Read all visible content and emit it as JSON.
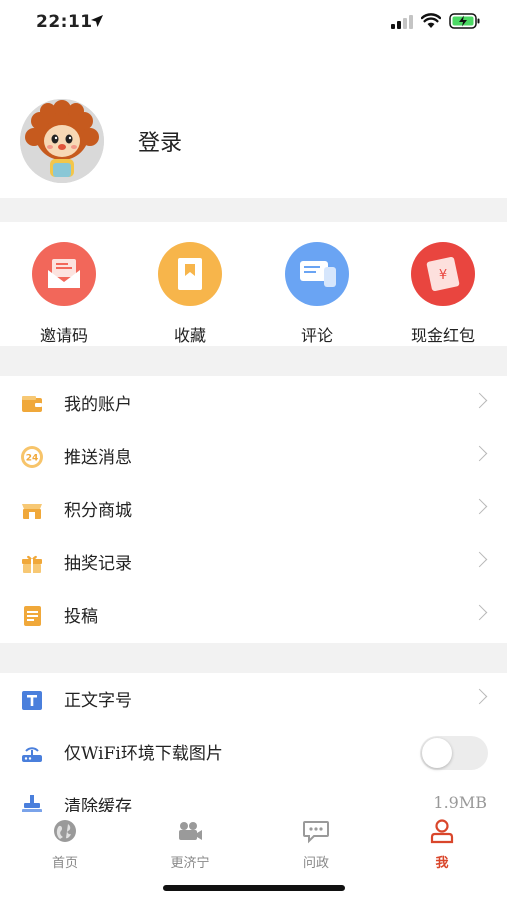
{
  "status": {
    "time": "22:11"
  },
  "profile": {
    "login_label": "登录"
  },
  "quick_actions": [
    {
      "label": "邀请码",
      "icon": "envelope-icon",
      "color": "#f2675a"
    },
    {
      "label": "收藏",
      "icon": "bookmark-icon",
      "color": "#f7b54b"
    },
    {
      "label": "评论",
      "icon": "comment-icon",
      "color": "#6aa4f3"
    },
    {
      "label": "现金红包",
      "icon": "red-packet-icon",
      "color": "#e9453f"
    }
  ],
  "menu_group_1": [
    {
      "label": "我的账户",
      "icon": "wallet-icon"
    },
    {
      "label": "推送消息",
      "icon": "clock-24-icon"
    },
    {
      "label": "积分商城",
      "icon": "shop-icon"
    },
    {
      "label": "抽奖记录",
      "icon": "gift-icon"
    },
    {
      "label": "投稿",
      "icon": "document-icon"
    }
  ],
  "menu_group_2": [
    {
      "label": "正文字号",
      "icon": "text-size-icon"
    },
    {
      "label": "仅WiFi环境下载图片",
      "icon": "router-icon",
      "toggle": false
    },
    {
      "label": "清除缓存",
      "icon": "clear-cache-icon",
      "value": "1.9MB"
    }
  ],
  "tabs": [
    {
      "label": "首页",
      "icon": "globe-icon",
      "active": false
    },
    {
      "label": "更济宁",
      "icon": "video-camera-icon",
      "active": false
    },
    {
      "label": "问政",
      "icon": "chat-icon",
      "active": false
    },
    {
      "label": "我",
      "icon": "person-icon",
      "active": true
    }
  ],
  "colors": {
    "accent": "#d9462b",
    "icon_orange": "#f0a83a",
    "icon_blue": "#4a7fdc"
  }
}
